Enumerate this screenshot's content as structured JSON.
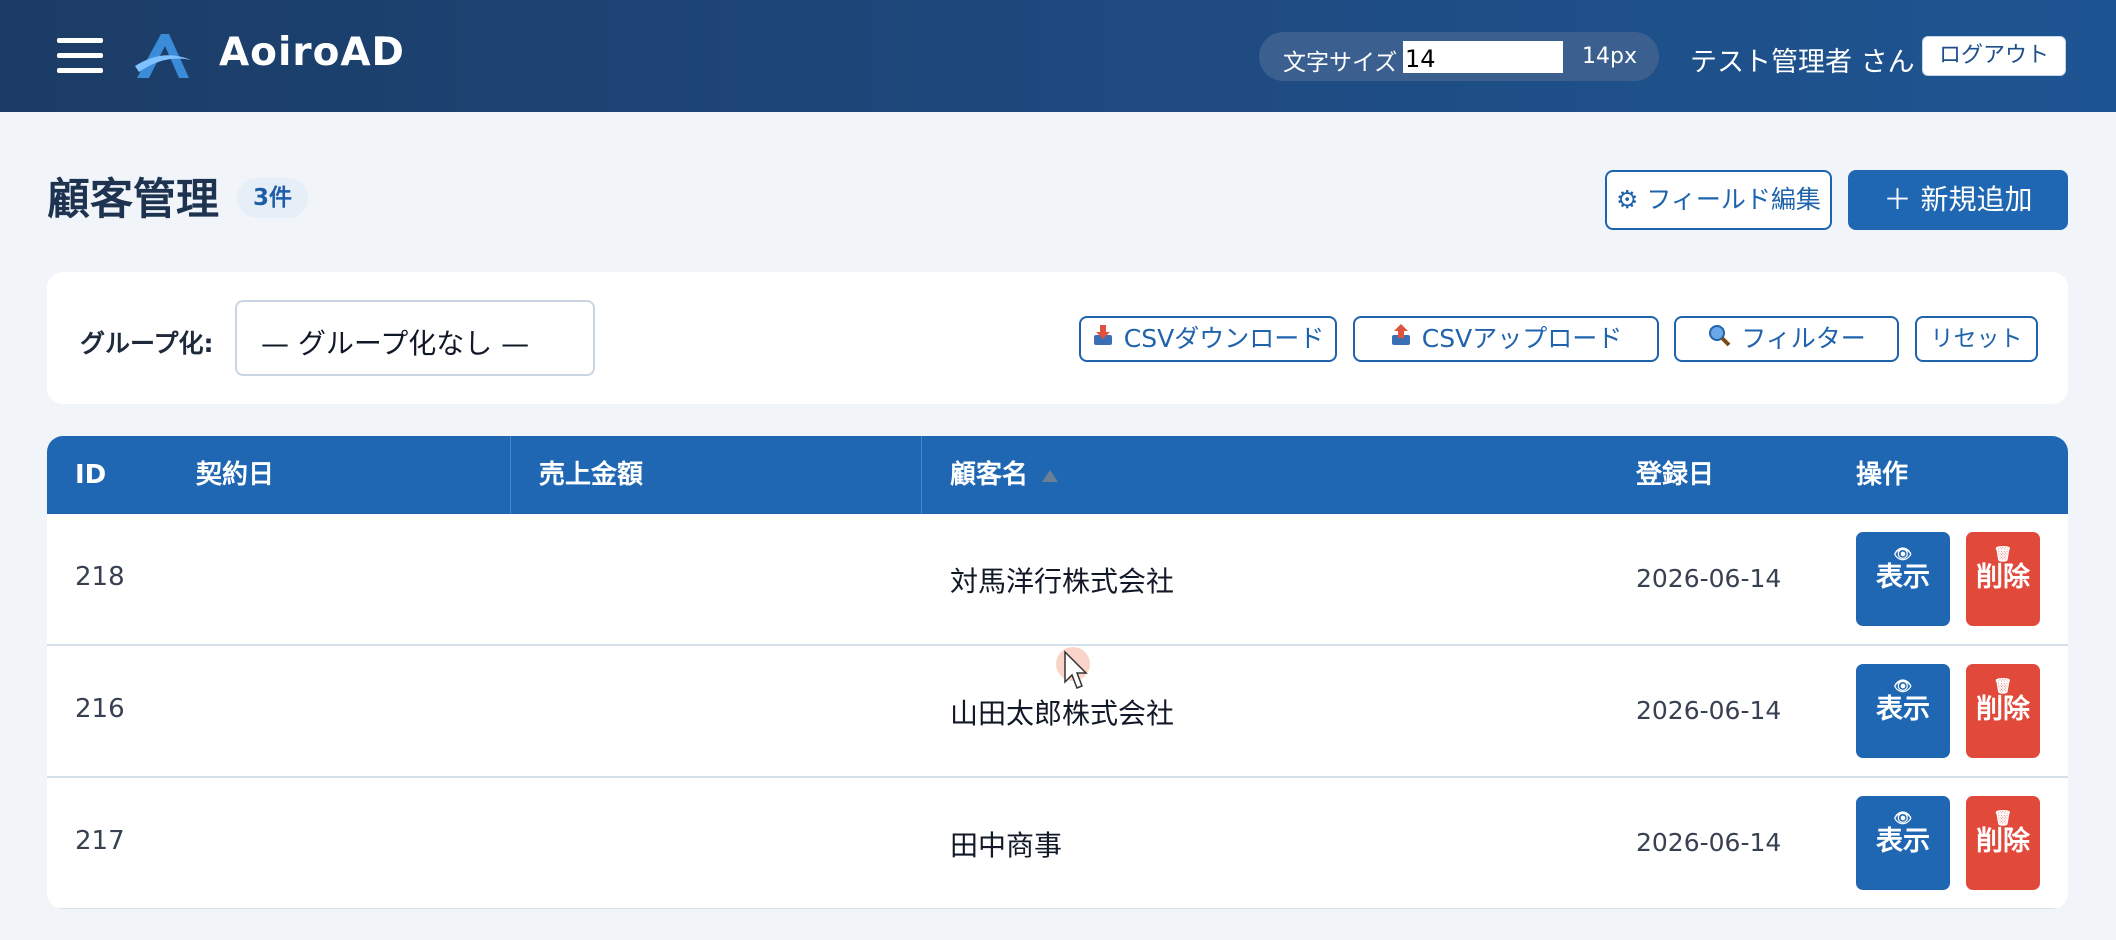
{
  "header": {
    "brand": "AoiroAD",
    "font_size_label": "文字サイズ",
    "font_size_value": "14",
    "font_size_unit": "14px",
    "user": "テスト管理者 さん",
    "logout": "ログアウト"
  },
  "page": {
    "title": "顧客管理",
    "count": "3件",
    "field_edit": "フィールド編集",
    "add_new": "新規追加"
  },
  "toolbar": {
    "group_label": "グループ化:",
    "group_select": "— グループ化なし —",
    "csv_download": "CSVダウンロード",
    "csv_upload": "CSVアップロード",
    "filter": "フィルター",
    "reset": "リセット"
  },
  "table": {
    "columns": [
      "ID",
      "契約日",
      "売上金額",
      "顧客名",
      "登録日",
      "操作"
    ],
    "rows": [
      {
        "id": "218",
        "contract_date": "",
        "sales": "",
        "name": "対馬洋行株式会社",
        "registered": "2026-06-14"
      },
      {
        "id": "216",
        "contract_date": "",
        "sales": "",
        "name": "山田太郎株式会社",
        "registered": "2026-06-14"
      },
      {
        "id": "217",
        "contract_date": "",
        "sales": "",
        "name": "田中商事",
        "registered": "2026-06-14"
      }
    ],
    "view_label": "表示",
    "delete_label": "削除"
  },
  "colors": {
    "header_bg": "#1f4a80",
    "primary": "#1f67b3",
    "danger": "#e1493a"
  }
}
